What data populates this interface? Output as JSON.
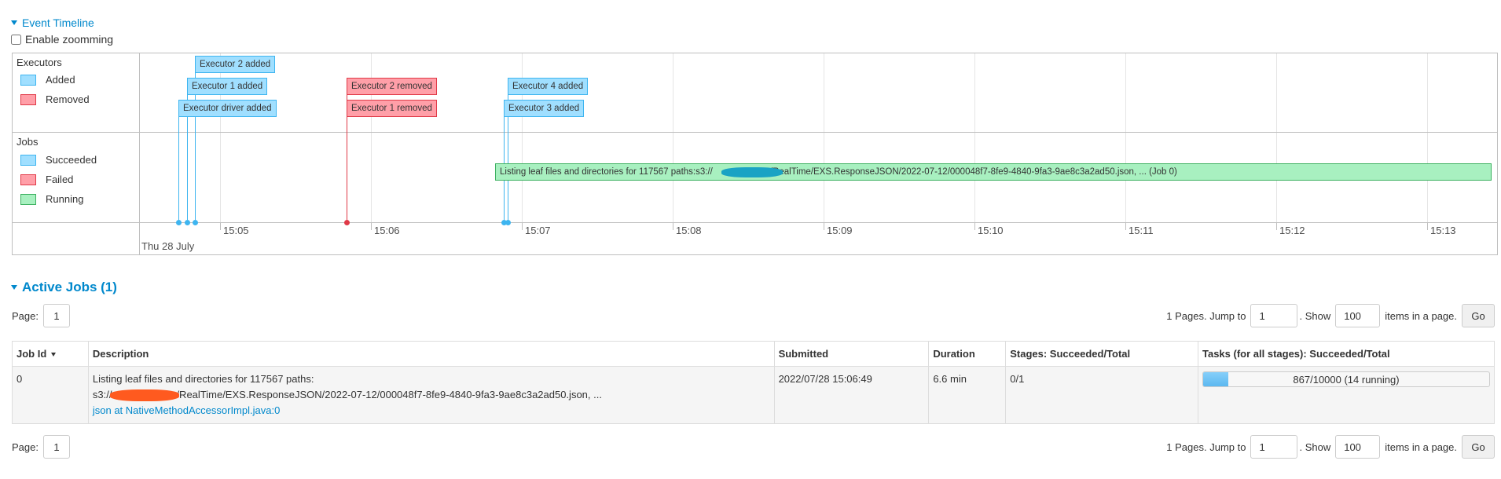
{
  "timeline": {
    "toggle_label": "Event Timeline",
    "zoom_label": "Enable zoomming",
    "executors_title": "Executors",
    "executors_legend": [
      {
        "label": "Added",
        "color": "#a0dfff"
      },
      {
        "label": "Removed",
        "color": "#ff9fa8"
      }
    ],
    "jobs_title": "Jobs",
    "jobs_legend": [
      {
        "label": "Succeeded",
        "color": "#a0dfff"
      },
      {
        "label": "Failed",
        "color": "#ff9fa8"
      },
      {
        "label": "Running",
        "color": "#a8f0c0"
      }
    ],
    "events": {
      "exec2_added": "Executor 2 added",
      "exec1_added": "Executor 1 added",
      "exec_driver_added": "Executor driver added",
      "exec2_removed": "Executor 2 removed",
      "exec1_removed": "Executor 1 removed",
      "exec4_added": "Executor 4 added",
      "exec3_added": "Executor 3 added",
      "job0_prefix": "Listing leaf files and directories for 117567 paths:s3://",
      "job0_suffix": "/RealTime/EXS.ResponseJSON/2022-07-12/000048f7-8fe9-4840-9fa3-9ae8c3a2ad50.json, ... (Job 0)"
    },
    "ticks": [
      "15:05",
      "15:06",
      "15:07",
      "15:08",
      "15:09",
      "15:10",
      "15:11",
      "15:12",
      "15:13"
    ],
    "date_label": "Thu 28 July"
  },
  "active_jobs": {
    "title": "Active Jobs (1)",
    "page_label": "Page:",
    "page_current": "1",
    "pages_text": "1 Pages. Jump to",
    "jump_value": "1",
    "show_text": ". Show",
    "show_value": "100",
    "items_text": "items in a page.",
    "go_label": "Go",
    "columns": [
      "Job Id",
      "Description",
      "Submitted",
      "Duration",
      "Stages: Succeeded/Total",
      "Tasks (for all stages): Succeeded/Total"
    ],
    "rows": [
      {
        "job_id": "0",
        "desc_line1": "Listing leaf files and directories for 117567 paths:",
        "desc_line2_prefix": "s3://",
        "desc_line2_suffix": "/RealTime/EXS.ResponseJSON/2022-07-12/000048f7-8fe9-4840-9fa3-9ae8c3a2ad50.json, ...",
        "desc_link": "json at NativeMethodAccessorImpl.java:0",
        "submitted": "2022/07/28 15:06:49",
        "duration": "6.6 min",
        "stages": "0/1",
        "tasks_text": "867/10000 (14 running)",
        "tasks_progress": 0.0867
      }
    ]
  }
}
